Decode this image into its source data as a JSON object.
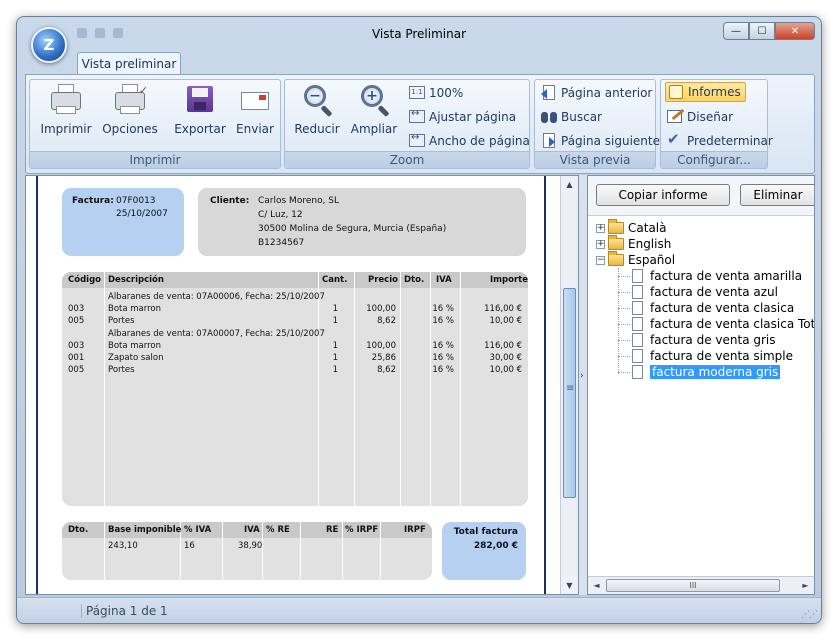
{
  "window": {
    "title": "Vista Preliminar",
    "orb_letter": "Z",
    "min_glyph": "—",
    "max_glyph": "☐",
    "close_glyph": "✕"
  },
  "ribbon": {
    "tab": "Vista preliminar",
    "groups": {
      "imprimir": {
        "label": "Imprimir",
        "buttons": [
          "Imprimir",
          "Opciones",
          "Exportar",
          "Enviar"
        ]
      },
      "zoom": {
        "label": "Zoom",
        "big": [
          "Reducir",
          "Ampliar"
        ],
        "small": [
          "100%",
          "Ajustar página",
          "Ancho de página"
        ]
      },
      "vista_previa": {
        "label": "Vista previa",
        "small": [
          "Página anterior",
          "Buscar",
          "Página siguiente"
        ]
      },
      "configurar": {
        "label": "Configurar...",
        "small": [
          "Informes",
          "Diseñar",
          "Predeterminar"
        ]
      }
    }
  },
  "invoice": {
    "factura_label": "Factura:",
    "factura_number": "07F0013",
    "factura_date": "25/10/2007",
    "cliente_label": "Cliente:",
    "cliente_lines": [
      "Carlos Moreno, SL",
      "C/ Luz, 12",
      "30500 Molina de Segura, Murcia (España)",
      "B1234567"
    ],
    "line_headers": [
      "Código",
      "Descripción",
      "Cant.",
      "Precio",
      "Dto.",
      "IVA",
      "Importe"
    ],
    "lines": [
      {
        "codigo": "",
        "desc": "Albaranes de venta: 07A00006, Fecha: 25/10/2007",
        "cant": "",
        "precio": "",
        "dto": "",
        "iva": "",
        "importe": ""
      },
      {
        "codigo": "003",
        "desc": "Bota marron",
        "cant": "1",
        "precio": "100,00",
        "dto": "",
        "iva": "16 %",
        "importe": "116,00 €"
      },
      {
        "codigo": "005",
        "desc": "Portes",
        "cant": "1",
        "precio": "8,62",
        "dto": "",
        "iva": "16 %",
        "importe": "10,00 €"
      },
      {
        "codigo": "",
        "desc": "Albaranes de venta: 07A00007, Fecha: 25/10/2007",
        "cant": "",
        "precio": "",
        "dto": "",
        "iva": "",
        "importe": ""
      },
      {
        "codigo": "003",
        "desc": "Bota marron",
        "cant": "1",
        "precio": "100,00",
        "dto": "",
        "iva": "16 %",
        "importe": "116,00 €"
      },
      {
        "codigo": "001",
        "desc": "Zapato salon",
        "cant": "1",
        "precio": "25,86",
        "dto": "",
        "iva": "16 %",
        "importe": "30,00 €"
      },
      {
        "codigo": "005",
        "desc": "Portes",
        "cant": "1",
        "precio": "8,62",
        "dto": "",
        "iva": "16 %",
        "importe": "10,00 €"
      }
    ],
    "total_headers": [
      "Dto.",
      "Base imponible",
      "% IVA",
      "IVA",
      "% RE",
      "RE",
      "% IRPF",
      "IRPF"
    ],
    "totals": {
      "dto": "",
      "base": "243,10",
      "pct_iva": "16",
      "iva": "38,90",
      "pct_re": "",
      "re": "",
      "pct_irpf": "",
      "irpf": ""
    },
    "total_factura_label": "Total factura",
    "total_factura_value": "282,00 €"
  },
  "right_panel": {
    "copy_button": "Copiar informe",
    "delete_button": "Eliminar",
    "tree": [
      {
        "label": "Català",
        "type": "folder",
        "expanded": false
      },
      {
        "label": "English",
        "type": "folder",
        "expanded": false
      },
      {
        "label": "Español",
        "type": "folder",
        "expanded": true
      },
      {
        "label": "factura de venta amarilla",
        "type": "doc"
      },
      {
        "label": "factura de venta azul",
        "type": "doc"
      },
      {
        "label": "factura de venta clasica",
        "type": "doc"
      },
      {
        "label": "factura de venta clasica Total Let",
        "type": "doc"
      },
      {
        "label": "factura de venta gris",
        "type": "doc"
      },
      {
        "label": "factura de venta simple",
        "type": "doc"
      },
      {
        "label": "factura moderna gris",
        "type": "doc",
        "selected": true
      }
    ],
    "scroll_grip": "III"
  },
  "status": {
    "page_info": "Página 1 de 1"
  },
  "colors": {
    "selection": "#3399ff",
    "invoice_blue": "#b6d0f2",
    "invoice_gray": "#d8d8d8",
    "page_border": "#1d2f64"
  }
}
